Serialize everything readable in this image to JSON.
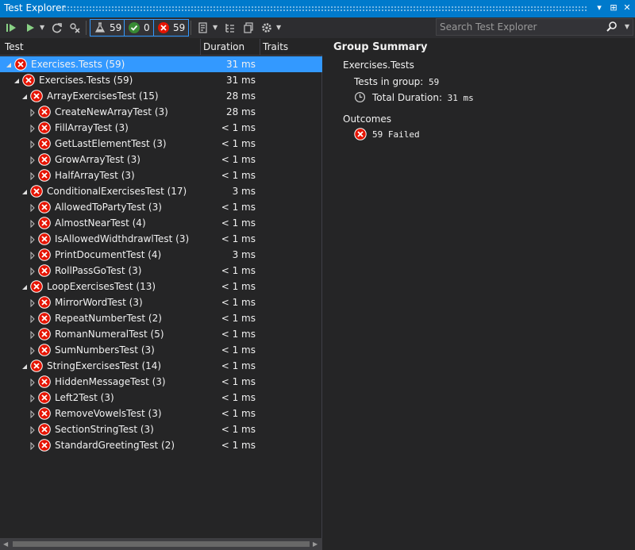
{
  "window": {
    "title": "Test Explorer"
  },
  "toolbar": {
    "total_count": "59",
    "passed_count": "0",
    "failed_count": "59"
  },
  "search": {
    "placeholder": "Search Test Explorer"
  },
  "columns": {
    "test": "Test",
    "duration": "Duration",
    "traits": "Traits"
  },
  "tree": [
    {
      "level": 0,
      "name": "Exercises.Tests (59)",
      "duration": "31 ms",
      "selected": true
    },
    {
      "level": 1,
      "name": "Exercises.Tests (59)",
      "duration": "31 ms"
    },
    {
      "level": 2,
      "name": "ArrayExercisesTest (15)",
      "duration": "28 ms"
    },
    {
      "level": 3,
      "name": "CreateNewArrayTest (3)",
      "duration": "28 ms"
    },
    {
      "level": 3,
      "name": "FillArrayTest (3)",
      "duration": "< 1 ms"
    },
    {
      "level": 3,
      "name": "GetLastElementTest (3)",
      "duration": "< 1 ms"
    },
    {
      "level": 3,
      "name": "GrowArrayTest (3)",
      "duration": "< 1 ms"
    },
    {
      "level": 3,
      "name": "HalfArrayTest (3)",
      "duration": "< 1 ms"
    },
    {
      "level": 2,
      "name": "ConditionalExercisesTest (17)",
      "duration": "3 ms"
    },
    {
      "level": 3,
      "name": "AllowedToPartyTest (3)",
      "duration": "< 1 ms"
    },
    {
      "level": 3,
      "name": "AlmostNearTest (4)",
      "duration": "< 1 ms"
    },
    {
      "level": 3,
      "name": "IsAllowedWidthdrawlTest (3)",
      "duration": "< 1 ms"
    },
    {
      "level": 3,
      "name": "PrintDocumentTest (4)",
      "duration": "3 ms"
    },
    {
      "level": 3,
      "name": "RollPassGoTest (3)",
      "duration": "< 1 ms"
    },
    {
      "level": 2,
      "name": "LoopExercisesTest (13)",
      "duration": "< 1 ms"
    },
    {
      "level": 3,
      "name": "MirrorWordTest (3)",
      "duration": "< 1 ms"
    },
    {
      "level": 3,
      "name": "RepeatNumberTest (2)",
      "duration": "< 1 ms"
    },
    {
      "level": 3,
      "name": "RomanNumeralTest (5)",
      "duration": "< 1 ms"
    },
    {
      "level": 3,
      "name": "SumNumbersTest (3)",
      "duration": "< 1 ms"
    },
    {
      "level": 2,
      "name": "StringExercisesTest (14)",
      "duration": "< 1 ms"
    },
    {
      "level": 3,
      "name": "HiddenMessageTest (3)",
      "duration": "< 1 ms"
    },
    {
      "level": 3,
      "name": "Left2Test (3)",
      "duration": "< 1 ms"
    },
    {
      "level": 3,
      "name": "RemoveVowelsTest (3)",
      "duration": "< 1 ms"
    },
    {
      "level": 3,
      "name": "SectionStringTest (3)",
      "duration": "< 1 ms"
    },
    {
      "level": 3,
      "name": "StandardGreetingTest (2)",
      "duration": "< 1 ms"
    }
  ],
  "summary": {
    "heading": "Group Summary",
    "group_name": "Exercises.Tests",
    "tests_label": "Tests in group:",
    "tests_value": "59",
    "duration_label": "Total Duration:",
    "duration_value": "31 ms",
    "outcomes_label": "Outcomes",
    "failed_text": "59 Failed"
  },
  "colors": {
    "accent": "#007acc",
    "selection": "#3399ff",
    "fail": "#e51400",
    "pass": "#388a34",
    "run_green": "#89d185"
  }
}
